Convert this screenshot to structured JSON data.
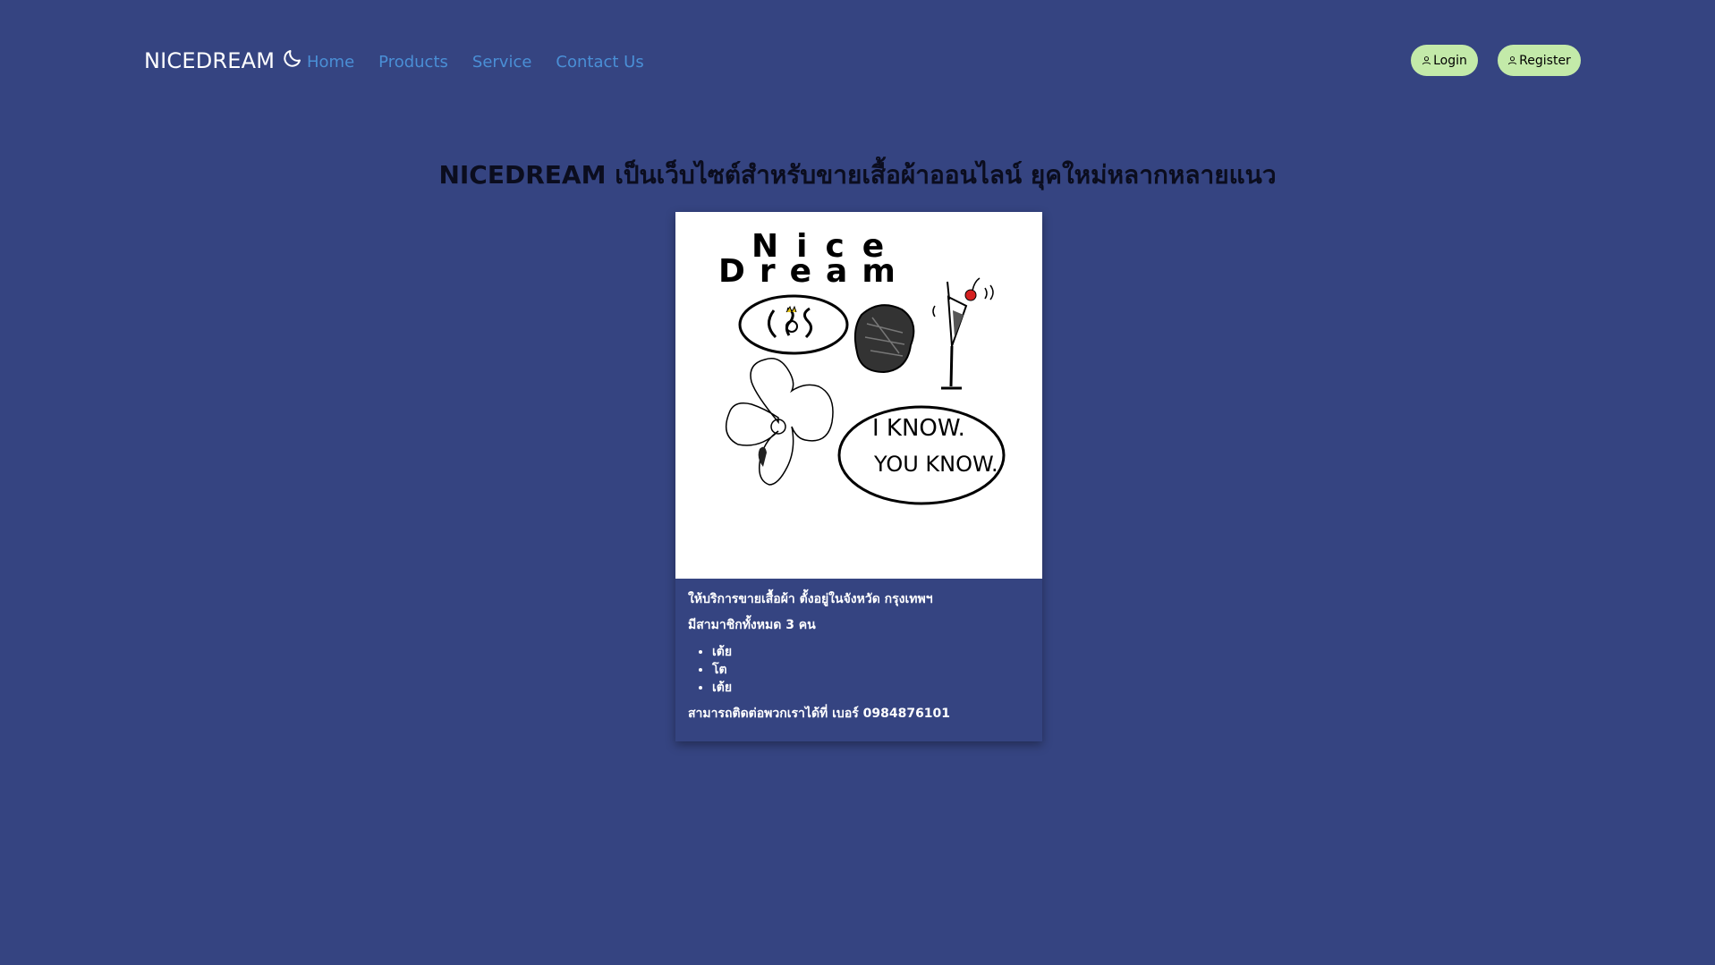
{
  "navbar": {
    "brand": "NICEDREAM",
    "theme_toggle_icon": "moon-icon",
    "links": [
      "Home",
      "Products",
      "Service",
      "Contact Us"
    ],
    "login_label": "Login",
    "register_label": "Register",
    "user_icon": "user-icon"
  },
  "main": {
    "headline": "NICEDREAM เป็นเว็บไซต์สำหรับขายเสื้อผ้าออนไลน์ ยุคใหม่หลากหลายแนว",
    "card": {
      "image_title_line1": "Nice",
      "image_title_line2": "Dream",
      "image_bubble_text_line1": "I KNOW.",
      "image_bubble_text_line2": "YOU KNOW.",
      "description": "ให้บริการขายเสื้อผ้า ตั้งอยู่ในจังหวัด กรุงเทพฯ",
      "members_text": "มีสามาชิกทั้งหมด 3 คน",
      "members": [
        "เต้ย",
        "โต",
        "เต้ย"
      ],
      "contact_text": "สามารถติดต่อพวกเราได้ที่ เบอร์ 0984876101"
    }
  },
  "colors": {
    "background": "#354481",
    "nav_link": "#4a8fd6",
    "button": "#c3eaa9",
    "headline": "#0b0d1e"
  }
}
